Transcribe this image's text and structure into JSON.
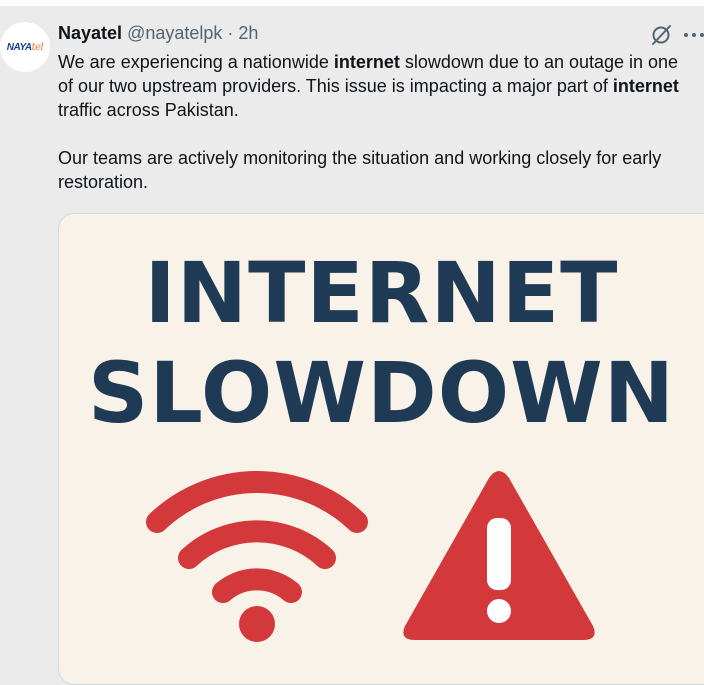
{
  "tweet": {
    "author_name": "Nayatel",
    "author_handle": "@nayatelpk",
    "separator": "·",
    "time": "2h",
    "avatar_logo": {
      "part1": "NAYA",
      "part2": "tel"
    },
    "paragraph1": [
      {
        "text": "We are experiencing a nationwide ",
        "bold": false
      },
      {
        "text": "internet",
        "bold": true
      },
      {
        "text": " slowdown due to an outage in one of our two upstream providers. This issue is impacting a major part of ",
        "bold": false
      },
      {
        "text": "internet",
        "bold": true
      },
      {
        "text": " traffic across Pakistan.",
        "bold": false
      }
    ],
    "paragraph2": "Our teams are actively monitoring the situation and working closely for early restoration."
  },
  "media": {
    "title_line1": "INTERNET",
    "title_line2": "SLOWDOWN",
    "icons": [
      "wifi-icon",
      "warning-icon"
    ],
    "colors": {
      "title": "#1e3a55",
      "icon_red": "#d3393b",
      "background": "#f8f2e9"
    }
  },
  "actions": {
    "grok_icon": "grok-icon",
    "more_icon": "more-icon"
  }
}
